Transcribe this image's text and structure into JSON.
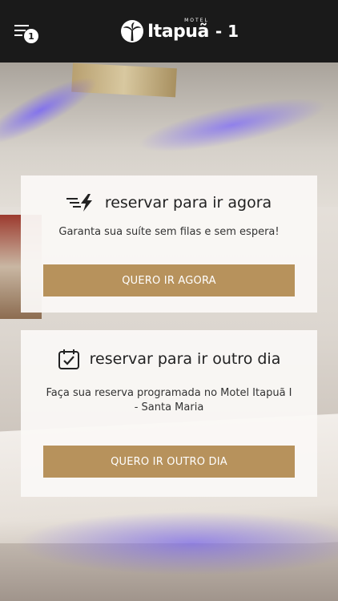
{
  "header": {
    "menu_badge": "1",
    "logo_small": "MOTEL",
    "logo_brand": "Itapuã",
    "logo_suffix": "- 1"
  },
  "cards": [
    {
      "title": "reservar para ir agora",
      "icon": "lightning-icon",
      "description": "Garanta sua suíte sem filas e sem espera!",
      "button": "QUERO IR AGORA"
    },
    {
      "title": "reservar para ir outro dia",
      "icon": "calendar-check-icon",
      "description": "Faça sua reserva programada no Motel Itapuã I - Santa Maria",
      "button": "QUERO IR OUTRO DIA"
    }
  ],
  "colors": {
    "header_bg": "#1a1a1a",
    "button_bg": "#b7925c",
    "accent_glow": "#6e5aff"
  }
}
